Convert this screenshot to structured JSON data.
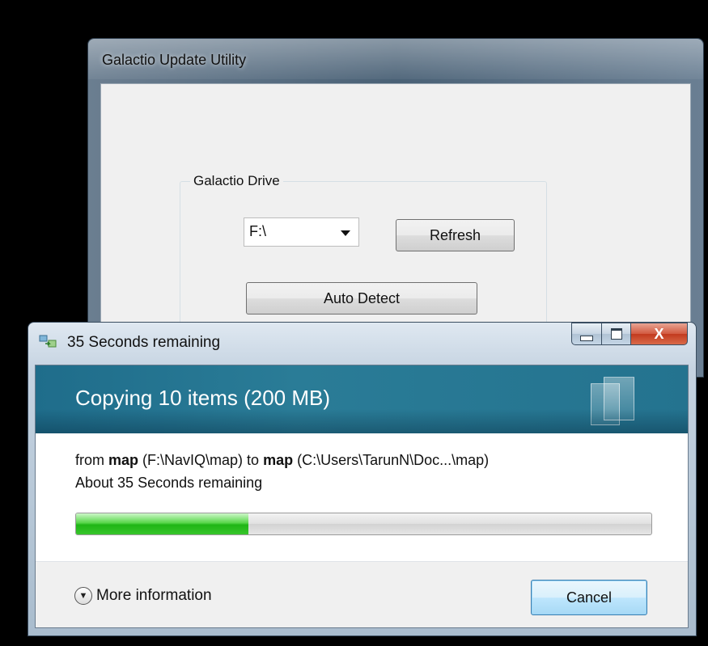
{
  "background_window": {
    "title": "Galactio Update Utility",
    "group_label": "Galactio Drive",
    "drive_select_value": "F:\\",
    "refresh_label": "Refresh",
    "auto_detect_label": "Auto Detect"
  },
  "copy_dialog": {
    "title": "35 Seconds remaining",
    "close_glyph": "X",
    "banner_text": "Copying 10 items (200 MB)",
    "from_prefix": "from ",
    "source_name": "map",
    "source_path": " (F:\\NavIQ\\map) to ",
    "dest_name": "map",
    "dest_path": " (C:\\Users\\TarunN\\Doc...\\map)",
    "remaining_text": "About 35 Seconds remaining",
    "progress_fraction": 0.3,
    "more_info_label": "More information",
    "cancel_label": "Cancel"
  },
  "icons": [
    "copy-files-icon",
    "minimize-icon",
    "maximize-icon",
    "close-icon",
    "documents-icon",
    "chevron-down-icon"
  ],
  "colors": {
    "banner": "#24738f",
    "progress_green": "#1fb515",
    "close_button": "#c23a1e"
  }
}
